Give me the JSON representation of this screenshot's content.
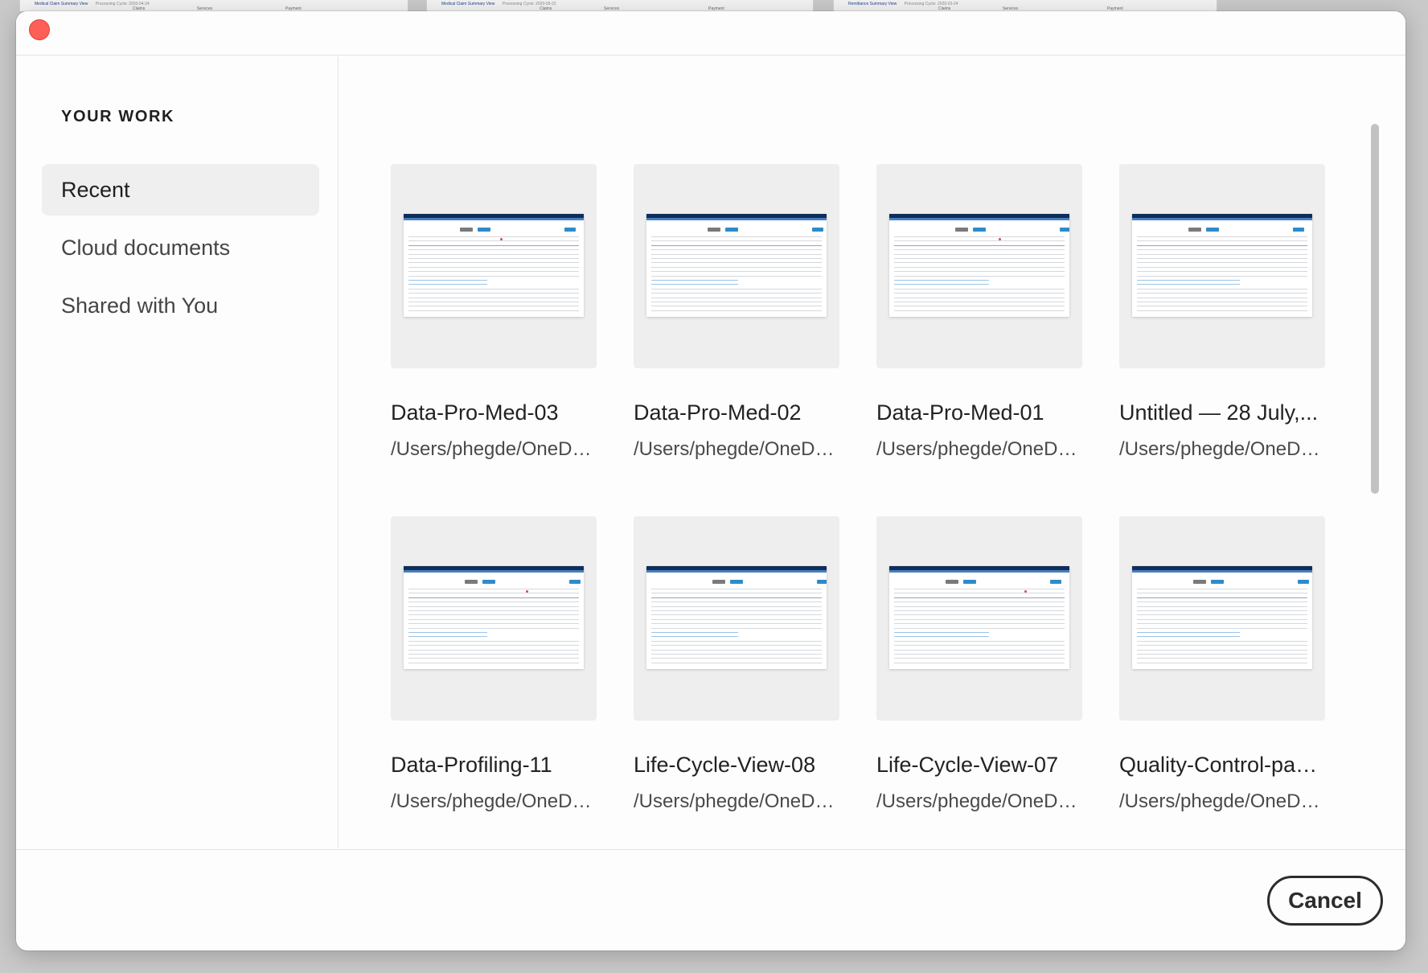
{
  "background": {
    "sheets": [
      {
        "title": "Medical Claim Summary View",
        "subtitle": "Processing Cycle: 2020-04-24",
        "cols": [
          "Claims",
          "Services",
          "Payment"
        ]
      },
      {
        "title": "Medical Claim Summary View",
        "subtitle": "Processing Cycle: 2020-05-22",
        "cols": [
          "Claims",
          "Services",
          "Payment"
        ]
      },
      {
        "title": "Remittance Summary View",
        "subtitle": "Processing Cycle: 2020-02-24",
        "cols": [
          "Claims",
          "Services",
          "Payment"
        ]
      }
    ]
  },
  "sidebar": {
    "heading": "YOUR WORK",
    "items": [
      {
        "label": "Recent",
        "active": true
      },
      {
        "label": "Cloud documents",
        "active": false
      },
      {
        "label": "Shared with You",
        "active": false
      }
    ]
  },
  "documents": [
    {
      "title": "Data-Pro-Med-03",
      "path": "/Users/phegde/OneDriv..."
    },
    {
      "title": "Data-Pro-Med-02",
      "path": "/Users/phegde/OneDriv..."
    },
    {
      "title": "Data-Pro-Med-01",
      "path": "/Users/phegde/OneDriv..."
    },
    {
      "title": "Untitled — 28 July,...",
      "path": "/Users/phegde/OneDriv..."
    },
    {
      "title": "Data-Profiling-11",
      "path": "/Users/phegde/OneDriv..."
    },
    {
      "title": "Life-Cycle-View-08",
      "path": "/Users/phegde/OneDriv..."
    },
    {
      "title": "Life-Cycle-View-07",
      "path": "/Users/phegde/OneDriv..."
    },
    {
      "title": "Quality-Control-pag...",
      "path": "/Users/phegde/OneDriv..."
    }
  ],
  "footer": {
    "cancel_label": "Cancel"
  },
  "colors": {
    "close_button": "#fd5f57",
    "thumbnail_header": "#0f2d5c",
    "thumbnail_accent": "#2e8bc9",
    "selected_nav_bg": "#efefef"
  }
}
